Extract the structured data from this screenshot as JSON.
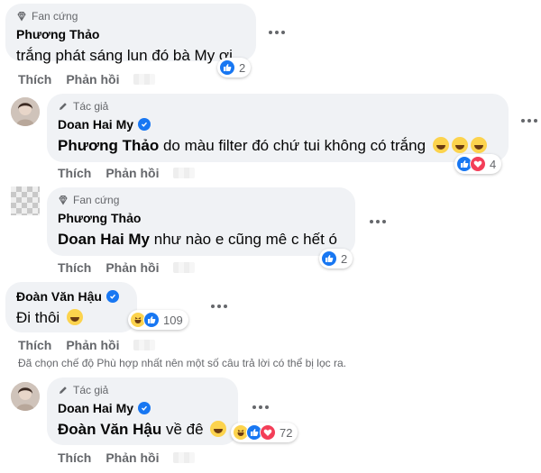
{
  "colors": {
    "bubble": "#f0f2f5",
    "blue": "#1877f2",
    "gray_text": "#65676b",
    "love": "#f33e58",
    "haha": "#fcd34d"
  },
  "c1": {
    "badge": "Fan cứng",
    "name": "Phương Thảo",
    "text": "trắng phát sáng lun đó bà My ơi",
    "reactions": [
      "like"
    ],
    "count": "2",
    "like": "Thích",
    "reply": "Phản hồi"
  },
  "c2": {
    "badge": "Tác giả",
    "name": "Doan Hai My",
    "mention": "Phương Thảo",
    "text": " do màu filter đó chứ tui không có trắng",
    "emojis": [
      "hand-over-mouth",
      "grinning",
      "rolling-laughing"
    ],
    "reactions": [
      "like",
      "love"
    ],
    "count": "4",
    "like": "Thích",
    "reply": "Phản hồi"
  },
  "c3": {
    "badge": "Fan cứng",
    "name": "Phương Thảo",
    "mention": "Doan Hai My",
    "text": " như nào e cũng mê c hết ó",
    "reactions": [
      "like"
    ],
    "count": "2",
    "like": "Thích",
    "reply": "Phản hồi"
  },
  "c4": {
    "name": "Đoàn Văn Hậu",
    "text": "Đi thôi",
    "emojis": [
      "squinting-laughing"
    ],
    "reactions": [
      "haha",
      "like"
    ],
    "count": "109",
    "like": "Thích",
    "reply": "Phản hồi"
  },
  "note": "Đã chọn chế độ Phù hợp nhất nên một số câu trả lời có thể bị lọc ra.",
  "c5": {
    "badge": "Tác giả",
    "name": "Doan Hai My",
    "mention": "Đoàn Văn Hậu",
    "text": " về đê",
    "emojis": [
      "grinning"
    ],
    "reactions": [
      "haha",
      "like",
      "love"
    ],
    "count": "72",
    "like": "Thích",
    "reply": "Phản hồi"
  }
}
